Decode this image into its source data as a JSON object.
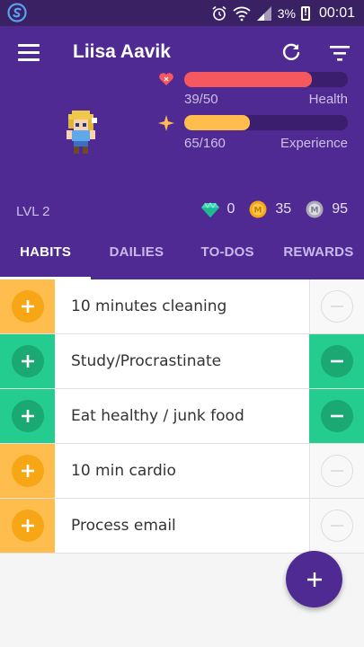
{
  "status_bar": {
    "battery_percent": "3%",
    "time": "00:01",
    "icons": [
      "s-app-icon",
      "alarm-icon",
      "wifi-icon",
      "signal-icon",
      "battery-icon"
    ]
  },
  "header": {
    "user_name": "Liisa Aavik",
    "health": {
      "value_text": "39/50",
      "label": "Health",
      "fraction": 0.78,
      "color": "#f6585f"
    },
    "experience": {
      "value_text": "65/160",
      "label": "Experience",
      "fraction": 0.4,
      "color": "#ffbd4e"
    },
    "level": "LVL 2",
    "gems": "0",
    "gold": "35",
    "silver": "95"
  },
  "tabs": [
    {
      "label": "HABITS",
      "active": true
    },
    {
      "label": "DAILIES",
      "active": false
    },
    {
      "label": "TO-DOS",
      "active": false
    },
    {
      "label": "REWARDS",
      "active": false
    }
  ],
  "habits": [
    {
      "text": "10 minutes cleaning",
      "color": "yellow",
      "up": true,
      "down_active": false
    },
    {
      "text": "Study/Procrastinate",
      "color": "green",
      "up": true,
      "down_active": true
    },
    {
      "text": "Eat healthy / junk food",
      "color": "green",
      "up": true,
      "down_active": true
    },
    {
      "text": "10 min cardio",
      "color": "yellow",
      "up": true,
      "down_active": false
    },
    {
      "text": "Process email",
      "color": "yellow",
      "up": true,
      "down_active": false
    }
  ],
  "colors": {
    "primary": "#4f2a93",
    "yellow_bg": "#ffbd4e",
    "yellow_circle": "#f7a616",
    "green_bg": "#24cc8f",
    "green_circle": "#1aa873"
  }
}
